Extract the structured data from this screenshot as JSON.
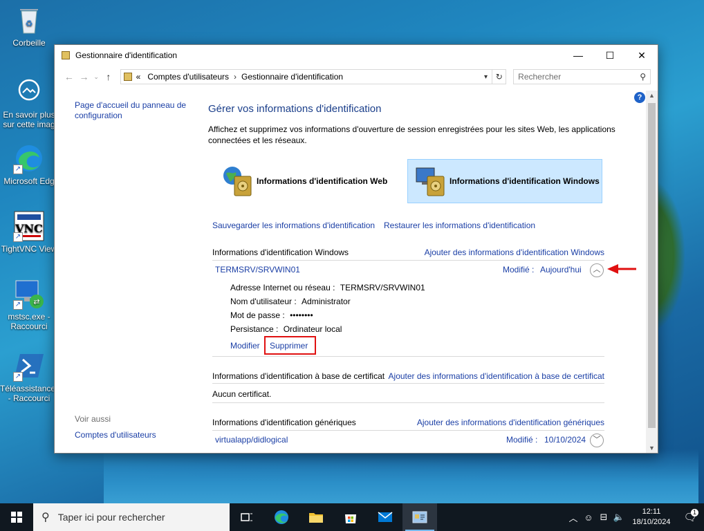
{
  "desktop": {
    "icons": [
      {
        "label_1": "Corbeille",
        "label_2": "",
        "icon": "recycle-bin-icon"
      },
      {
        "label_1": "En savoir plus",
        "label_2": "sur cette imag",
        "icon": "info-camera-icon"
      },
      {
        "label_1": "Microsoft Edg",
        "label_2": "",
        "icon": "edge-icon"
      },
      {
        "label_1": "TightVNC View",
        "label_2": "",
        "icon": "vnc-icon"
      },
      {
        "label_1": "mstsc.exe -",
        "label_2": "Raccourci",
        "icon": "remote-desktop-icon"
      },
      {
        "label_1": "Téléassistance..",
        "label_2": "- Raccourci",
        "icon": "powershell-icon"
      }
    ]
  },
  "window": {
    "title": "Gestionnaire d'identification",
    "nav": {
      "crumb_prefix": "«",
      "crumbs": [
        "Comptes d'utilisateurs",
        "Gestionnaire d'identification"
      ],
      "search_placeholder": "Rechercher"
    },
    "left_pane": {
      "home_link_1": "Page d'accueil du panneau de",
      "home_link_2": "configuration",
      "see_also": "Voir aussi",
      "user_accounts_link": "Comptes d'utilisateurs"
    },
    "main": {
      "title": "Gérer vos informations d'identification",
      "description_1": "Affichez et supprimez vos informations d'ouverture de session enregistrées pour les sites Web, les applications",
      "description_2": "connectées et les réseaux.",
      "tiles": {
        "web": "Informations d'identification Web",
        "windows": "Informations d'identification Windows"
      },
      "backup_link": "Sauvegarder les informations d'identification",
      "restore_link": "Restaurer les informations d'identification",
      "windows_section": {
        "heading": "Informations d'identification Windows",
        "add_link": "Ajouter des informations d'identification Windows",
        "entry": {
          "name": "TERMSRV/SRVWIN01",
          "modified_label": "Modifié :",
          "modified_value": "Aujourd'hui",
          "address_label": "Adresse Internet ou réseau :",
          "address_value": "TERMSRV/SRVWIN01",
          "user_label": "Nom d'utilisateur :",
          "user_value": "Administrator",
          "password_label": "Mot de passe :",
          "password_value": "••••••••",
          "persistence_label": "Persistance :",
          "persistence_value": "Ordinateur local",
          "edit_link": "Modifier",
          "delete_link": "Supprimer"
        }
      },
      "cert_section": {
        "heading": "Informations d'identification à base de certificat",
        "add_link": "Ajouter des informations d'identification à base de certificat",
        "empty": "Aucun certificat."
      },
      "generic_section": {
        "heading": "Informations d'identification génériques",
        "add_link": "Ajouter des informations d'identification génériques",
        "entry": {
          "name": "virtualapp/didlogical",
          "modified_label": "Modifié :",
          "modified_value": "10/10/2024"
        }
      }
    }
  },
  "taskbar": {
    "search_placeholder": "Taper ici pour rechercher",
    "clock_time": "12:11",
    "clock_date": "18/10/2024",
    "notification_count": "1"
  },
  "colors": {
    "link": "#1a3ea5",
    "title": "#1a3e8a",
    "selected_tile": "#cce8ff",
    "annotation_red": "#e01010",
    "taskbar": "#101820"
  }
}
